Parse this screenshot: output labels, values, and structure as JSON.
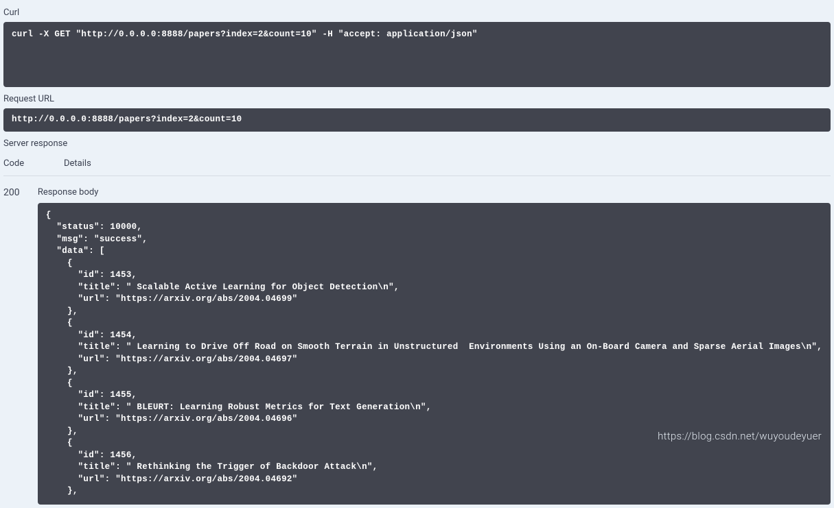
{
  "labels": {
    "curl": "Curl",
    "request_url": "Request URL",
    "server_response": "Server response",
    "code": "Code",
    "details": "Details",
    "response_body": "Response body"
  },
  "curl_command": "curl -X GET \"http://0.0.0.0:8888/papers?index=2&count=10\" -H \"accept: application/json\"",
  "request_url": "http://0.0.0.0:8888/papers?index=2&count=10",
  "status_code": "200",
  "response_body": "{\n  \"status\": 10000,\n  \"msg\": \"success\",\n  \"data\": [\n    {\n      \"id\": 1453,\n      \"title\": \" Scalable Active Learning for Object Detection\\n\",\n      \"url\": \"https://arxiv.org/abs/2004.04699\"\n    },\n    {\n      \"id\": 1454,\n      \"title\": \" Learning to Drive Off Road on Smooth Terrain in Unstructured  Environments Using an On-Board Camera and Sparse Aerial Images\\n\",\n      \"url\": \"https://arxiv.org/abs/2004.04697\"\n    },\n    {\n      \"id\": 1455,\n      \"title\": \" BLEURT: Learning Robust Metrics for Text Generation\\n\",\n      \"url\": \"https://arxiv.org/abs/2004.04696\"\n    },\n    {\n      \"id\": 1456,\n      \"title\": \" Rethinking the Trigger of Backdoor Attack\\n\",\n      \"url\": \"https://arxiv.org/abs/2004.04692\"\n    },",
  "watermark": "https://blog.csdn.net/wuyoudeyuer"
}
